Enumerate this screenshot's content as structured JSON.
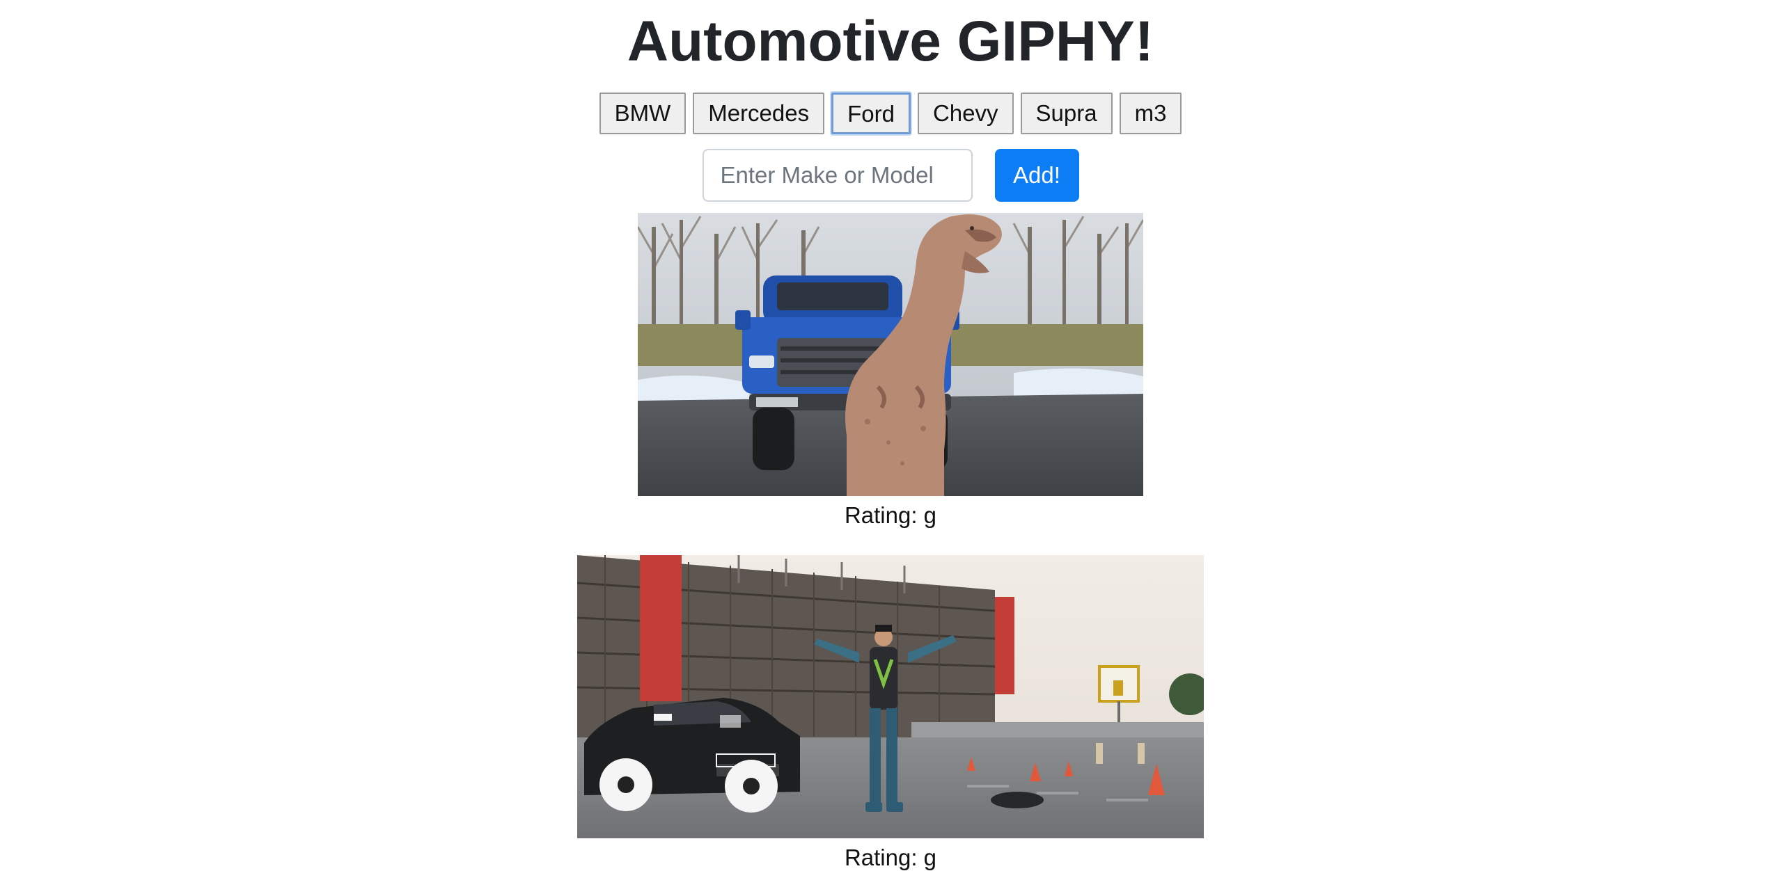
{
  "header": {
    "title": "Automotive GIPHY!"
  },
  "topics": [
    "BMW",
    "Mercedes",
    "Ford",
    "Chevy",
    "Supra",
    "m3"
  ],
  "form": {
    "placeholder": "Enter Make or Model",
    "add_label": "Add!"
  },
  "gifs": [
    {
      "rating_label": "Rating: g"
    },
    {
      "rating_label": "Rating: g"
    }
  ],
  "colors": {
    "accent": "#0d7df5",
    "focus": "#6e9ad8"
  }
}
